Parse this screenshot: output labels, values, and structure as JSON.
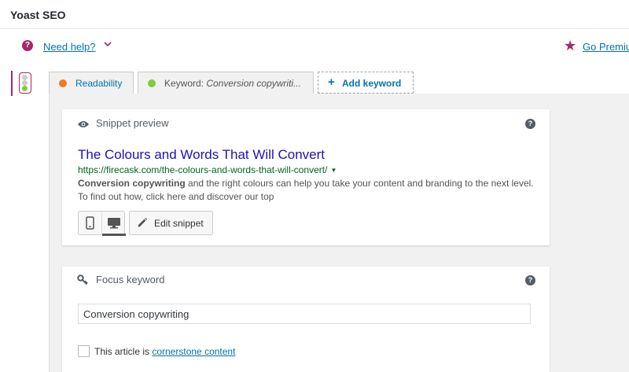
{
  "panel": {
    "title": "Yoast SEO"
  },
  "help": {
    "icon": "question-circle-icon",
    "label": "Need help?",
    "chevron": "⌄"
  },
  "premium": {
    "icon": "star-icon",
    "label": "Go Premium"
  },
  "status": {
    "icon": "traffic-light-icon"
  },
  "tabs": {
    "readability": {
      "label": "Readability",
      "dot_color": "#ee7c1b"
    },
    "keyword": {
      "label_prefix": "Keyword: ",
      "label_keyword": "Conversion copywriti...",
      "dot_color": "#7ad03a"
    },
    "add": {
      "label": "Add keyword"
    }
  },
  "snippet": {
    "title": "Snippet preview",
    "serp_title": "The Colours and Words That Will Convert",
    "serp_url": "https://firecask.com/the-colours-and-words-that-will-convert/",
    "desc_bold": "Conversion copywriting",
    "desc_rest": " and the right colours can help you take your content and branding to the next level. To find out how, click here and discover our top",
    "edit_label": "Edit snippet"
  },
  "focus": {
    "title": "Focus keyword",
    "value": "Conversion copywriting",
    "cornerstone_prefix": "This article is ",
    "cornerstone_link": "cornerstone content"
  },
  "colors": {
    "brand": "#a4286a",
    "link": "#0073aa",
    "serp_title": "#1e0fbe",
    "serp_url": "#006621"
  }
}
